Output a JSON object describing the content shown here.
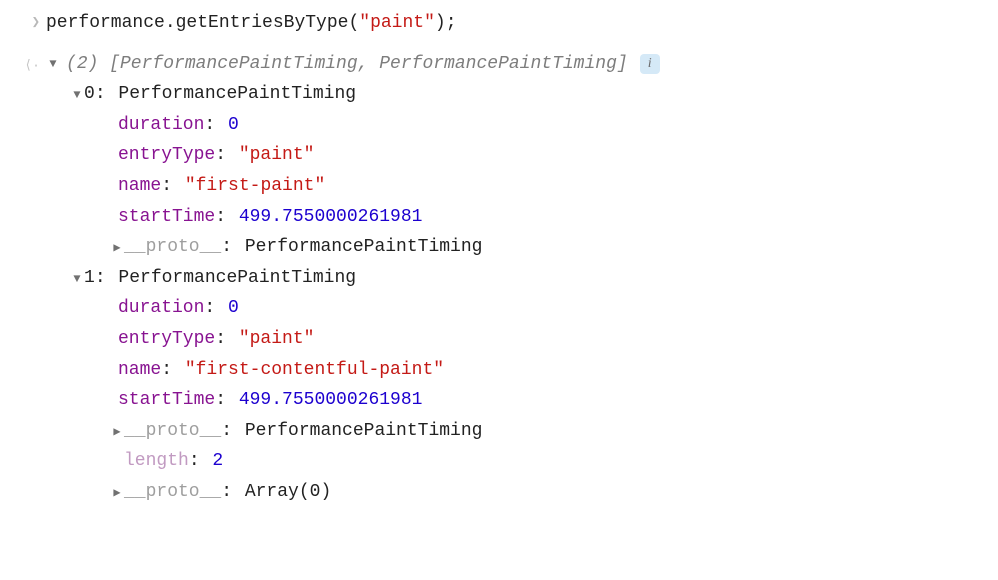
{
  "input": {
    "text_pre": "performance.getEntriesByType(",
    "arg": "\"paint\"",
    "text_post": ");"
  },
  "result": {
    "summary": "(2) [PerformancePaintTiming, PerformancePaintTiming]",
    "info_badge": "i",
    "entries": [
      {
        "index": "0",
        "classname": "PerformancePaintTiming",
        "props": {
          "duration_key": "duration",
          "duration_val": "0",
          "entryType_key": "entryType",
          "entryType_val": "\"paint\"",
          "name_key": "name",
          "name_val": "\"first-paint\"",
          "startTime_key": "startTime",
          "startTime_val": "499.7550000261981",
          "proto_key": "__proto__",
          "proto_val": "PerformancePaintTiming"
        }
      },
      {
        "index": "1",
        "classname": "PerformancePaintTiming",
        "props": {
          "duration_key": "duration",
          "duration_val": "0",
          "entryType_key": "entryType",
          "entryType_val": "\"paint\"",
          "name_key": "name",
          "name_val": "\"first-contentful-paint\"",
          "startTime_key": "startTime",
          "startTime_val": "499.7550000261981",
          "proto_key": "__proto__",
          "proto_val": "PerformancePaintTiming"
        }
      }
    ],
    "length_key": "length",
    "length_val": "2",
    "proto_key": "__proto__",
    "proto_val": "Array(0)"
  }
}
